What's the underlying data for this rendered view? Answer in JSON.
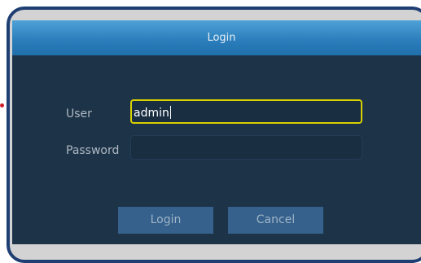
{
  "dialog": {
    "title": "Login",
    "user_label": "User",
    "user_value": "admin",
    "password_label": "Password",
    "password_value": "",
    "login_button": "Login",
    "cancel_button": "Cancel"
  },
  "colors": {
    "frame_border": "#1f3f73",
    "titlebar": "#2b7fbc",
    "dialog_background": "#1d3347",
    "focus_border": "#d8d000",
    "button": "#35618c"
  }
}
